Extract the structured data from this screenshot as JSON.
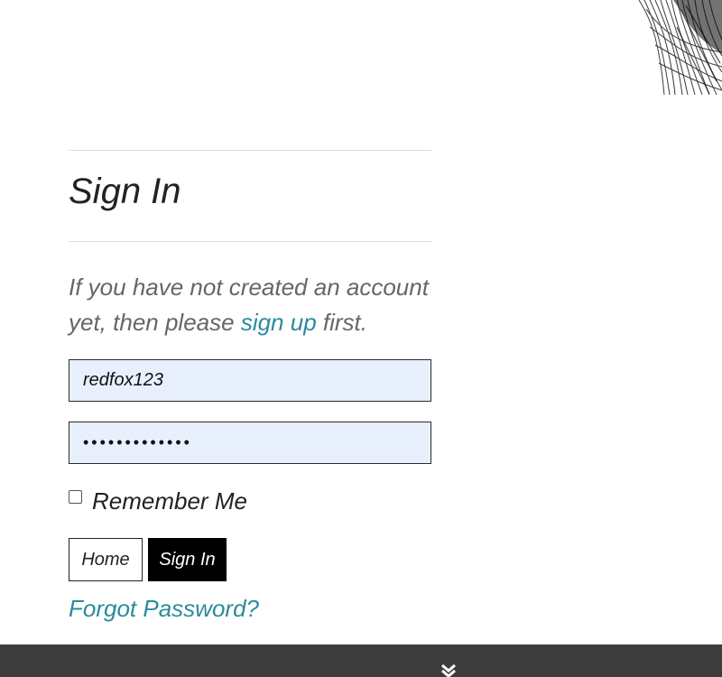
{
  "signin": {
    "title": "Sign In",
    "intro_prefix": "If you have not created an account yet, then please ",
    "signup_link": "sign up",
    "intro_suffix": " first.",
    "username_value": "redfox123",
    "password_mask": "•••••••••••••",
    "remember_label": "Remember Me",
    "remember_checked": false,
    "home_button": "Home",
    "signin_button": "Sign In",
    "forgot_link": "Forgot Password?"
  },
  "footer": {
    "expand_icon": "chevron-down-icon"
  },
  "colors": {
    "link": "#2a8b9b",
    "input_bg": "#e8f0fe",
    "footer_bg": "#3c3c3c",
    "primary_button_bg": "#000000"
  }
}
